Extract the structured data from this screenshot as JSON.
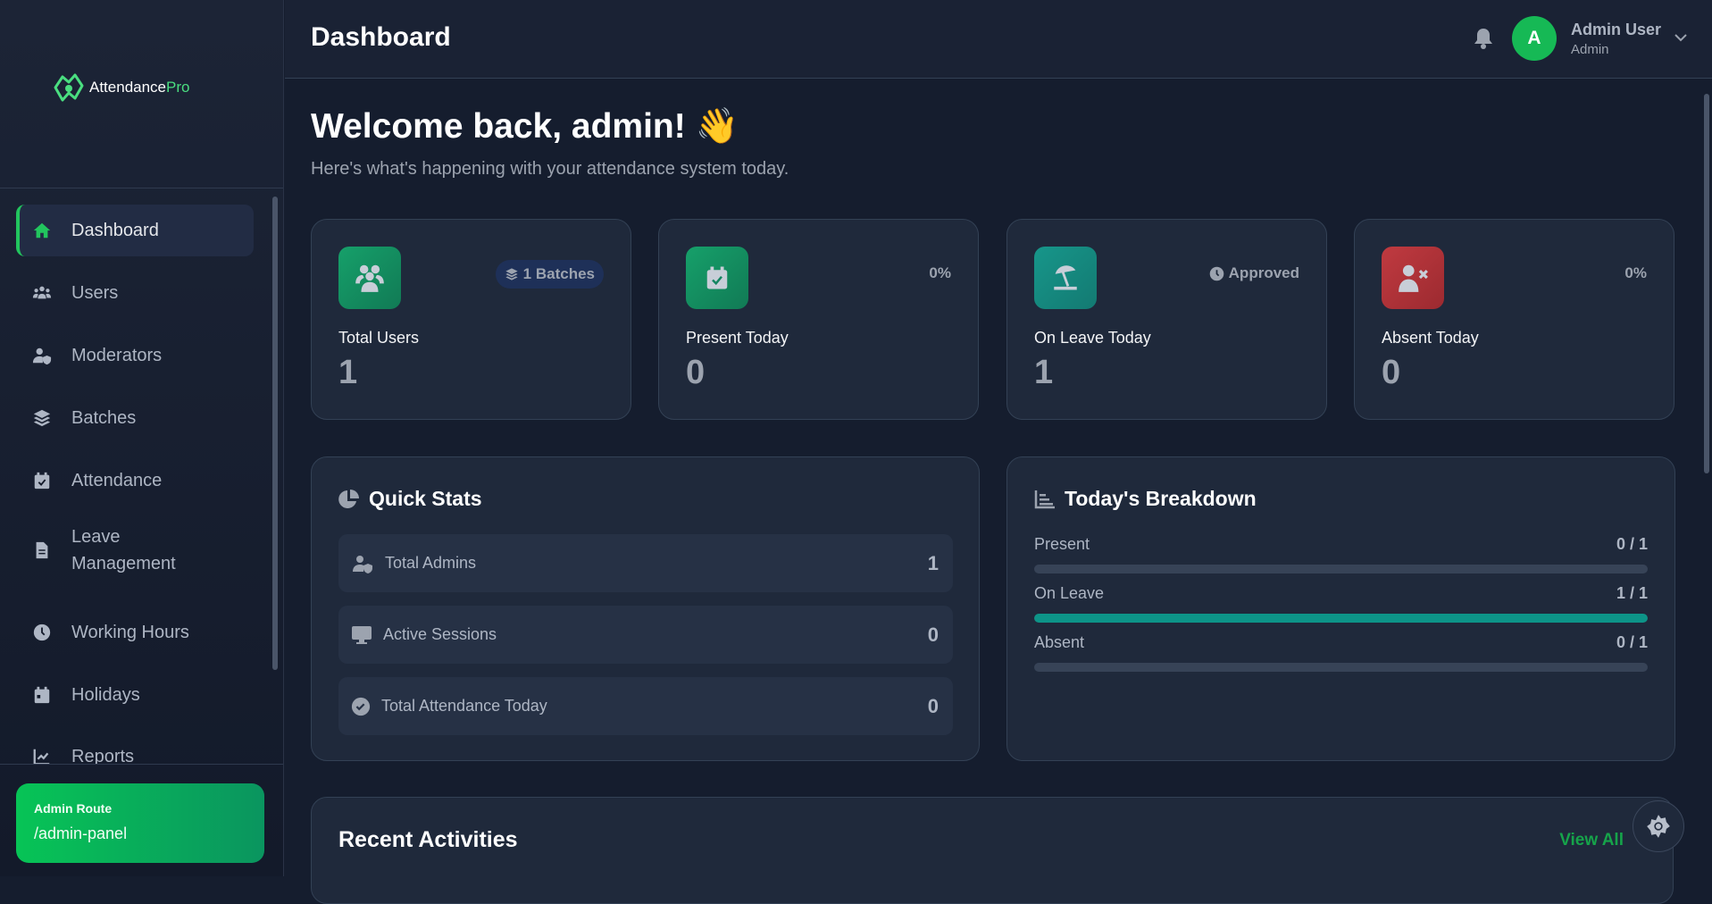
{
  "brand": {
    "name": "Attendance",
    "suffix": "Pro"
  },
  "sidebar": {
    "items": [
      {
        "label": "Dashboard",
        "icon": "home-icon",
        "active": true
      },
      {
        "label": "Users",
        "icon": "users-icon"
      },
      {
        "label": "Moderators",
        "icon": "user-shield-icon"
      },
      {
        "label": "Batches",
        "icon": "layers-icon"
      },
      {
        "label": "Attendance",
        "icon": "calendar-check-icon"
      },
      {
        "label": "Leave Management",
        "icon": "file-icon"
      },
      {
        "label": "Working Hours",
        "icon": "clock-icon"
      },
      {
        "label": "Holidays",
        "icon": "calendar-icon"
      },
      {
        "label": "Reports",
        "icon": "chart-line-icon"
      }
    ],
    "route": {
      "title": "Admin Route",
      "value": "/admin-panel"
    }
  },
  "header": {
    "title": "Dashboard",
    "user": {
      "initial": "A",
      "name": "Admin User",
      "role": "Admin"
    }
  },
  "welcome": {
    "title": "Welcome back, admin! 👋",
    "subtitle": "Here's what's happening with your attendance system today."
  },
  "cards": [
    {
      "label": "Total Users",
      "value": "1",
      "badge": "1 Batches",
      "color": "#14895f"
    },
    {
      "label": "Present Today",
      "value": "0",
      "badge": "0%",
      "color": "#14895f"
    },
    {
      "label": "On Leave Today",
      "value": "1",
      "badge": "Approved",
      "color": "#178a80"
    },
    {
      "label": "Absent Today",
      "value": "0",
      "badge": "0%",
      "color": "#b3313a"
    }
  ],
  "quick_stats": {
    "title": "Quick Stats",
    "rows": [
      {
        "label": "Total Admins",
        "value": "1"
      },
      {
        "label": "Active Sessions",
        "value": "0"
      },
      {
        "label": "Total Attendance Today",
        "value": "0"
      }
    ]
  },
  "breakdown": {
    "title": "Today's Breakdown",
    "rows": [
      {
        "label": "Present",
        "value": "0 / 1",
        "fraction": 0
      },
      {
        "label": "On Leave",
        "value": "1 / 1",
        "fraction": 1
      },
      {
        "label": "Absent",
        "value": "0 / 1",
        "fraction": 0
      }
    ]
  },
  "recent": {
    "title": "Recent Activities",
    "view_all": "View All"
  }
}
